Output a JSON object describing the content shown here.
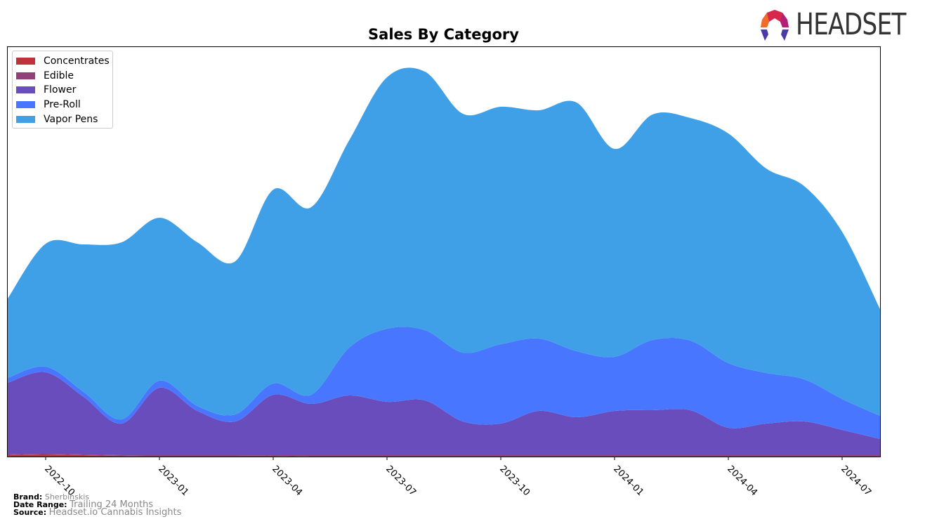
{
  "logo": {
    "text": "HEADSET",
    "icon": "headset-logo-icon"
  },
  "chart_data": {
    "type": "area",
    "stacked": true,
    "smoothed": true,
    "title": "Sales By Category",
    "xlabel": "",
    "ylabel": "",
    "y_axis_labels_visible": false,
    "x": [
      "2022-09",
      "2022-10",
      "2022-11",
      "2022-12",
      "2023-01",
      "2023-02",
      "2023-03",
      "2023-04",
      "2023-05",
      "2023-06",
      "2023-07",
      "2023-08",
      "2023-09",
      "2023-10",
      "2023-11",
      "2023-12",
      "2024-01",
      "2024-02",
      "2024-03",
      "2024-04",
      "2024-05",
      "2024-06",
      "2024-07",
      "2024-08"
    ],
    "x_tick_labels": [
      "2022-10",
      "2023-01",
      "2023-04",
      "2023-07",
      "2023-10",
      "2024-01",
      "2024-04",
      "2024-07"
    ],
    "ylim": [
      0,
      584
    ],
    "grid": false,
    "legend_position": "top-left",
    "series": [
      {
        "name": "Concentrates",
        "color": "#c0323a",
        "values": [
          2,
          3,
          2,
          1,
          1,
          1,
          1,
          1,
          0,
          0,
          0,
          0,
          0,
          0,
          0,
          0,
          0,
          0,
          0,
          0,
          0,
          0,
          0,
          0
        ]
      },
      {
        "name": "Edible",
        "color": "#923f7a",
        "values": [
          1,
          1,
          1,
          1,
          1,
          1,
          1,
          1,
          2,
          2,
          2,
          2,
          2,
          2,
          2,
          2,
          2,
          2,
          2,
          2,
          2,
          2,
          2,
          2
        ]
      },
      {
        "name": "Flower",
        "color": "#6a4dbc",
        "values": [
          102,
          116,
          82,
          45,
          96,
          63,
          48,
          86,
          73,
          85,
          76,
          78,
          48,
          45,
          63,
          54,
          63,
          64,
          64,
          39,
          45,
          48,
          36,
          23
        ]
      },
      {
        "name": "Pre-Roll",
        "color": "#4876ff",
        "values": [
          7,
          8,
          7,
          6,
          10,
          7,
          10,
          16,
          13,
          68,
          104,
          100,
          98,
          113,
          103,
          94,
          77,
          100,
          99,
          92,
          72,
          60,
          44,
          33
        ]
      },
      {
        "name": "Vapor Pens",
        "color": "#3fa0e8",
        "values": [
          113,
          175,
          210,
          252,
          232,
          233,
          218,
          276,
          267,
          295,
          358,
          368,
          340,
          338,
          325,
          354,
          296,
          321,
          317,
          327,
          291,
          275,
          238,
          152
        ]
      }
    ]
  },
  "footer": {
    "brand_label": "Brand:",
    "brand_value": "Sherbinskis",
    "date_range_label": "Date Range:",
    "date_range_value": "Trailing 24 Months",
    "source_label": "Source:",
    "source_value": "Headset.io Cannabis Insights"
  }
}
